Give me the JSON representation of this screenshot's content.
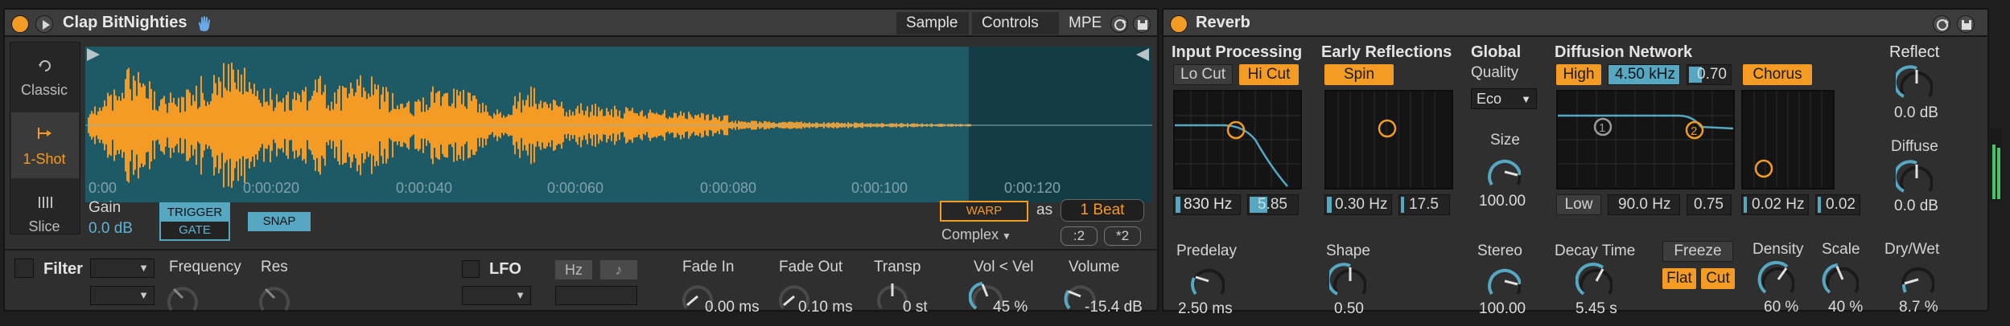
{
  "simpler": {
    "title": "Clap BitNighties",
    "tabs": [
      "Sample",
      "Controls",
      "MPE"
    ],
    "modes": {
      "classic": "Classic",
      "oneshot": "1-Shot",
      "slice": "Slice"
    },
    "timeline": [
      "0:00",
      "0:00:020",
      "0:00:040",
      "0:00:060",
      "0:00:080",
      "0:00:100",
      "0:00:120"
    ],
    "gain_label": "Gain",
    "gain_value": "0.0 dB",
    "trigger_label": "TRIGGER",
    "gate_label": "GATE",
    "snap_label": "SNAP",
    "warp_label": "WARP",
    "as_label": "as",
    "beat_value": "1 Beat",
    "warp_mode": "Complex",
    "half_label": ":2",
    "double_label": "*2",
    "filter_label": "Filter",
    "frequency_label": "Frequency",
    "res_label": "Res",
    "lfo_label": "LFO",
    "hz_label": "Hz",
    "note_glyph": "♪",
    "fade_in_label": "Fade In",
    "fade_in_value": "0.00 ms",
    "fade_out_label": "Fade Out",
    "fade_out_value": "0.10 ms",
    "transp_label": "Transp",
    "transp_value": "0 st",
    "volvel_label": "Vol < Vel",
    "volvel_value": "45 %",
    "volume_label": "Volume",
    "volume_value": "-15.4 dB"
  },
  "reverb": {
    "title": "Reverb",
    "input_processing": "Input Processing",
    "lo_cut": "Lo Cut",
    "hi_cut": "Hi Cut",
    "ip_freq": "830 Hz",
    "ip_q": "5.85",
    "early_reflections": "Early Reflections",
    "spin": "Spin",
    "er_amount": "0.30 Hz",
    "er_depth": "17.5",
    "global_label": "Global",
    "quality_label": "Quality",
    "quality_value": "Eco",
    "size_label": "Size",
    "size_value": "100.00",
    "diffusion_network": "Diffusion Network",
    "high_label": "High",
    "high_freq": "4.50 kHz",
    "high_q": "0.70",
    "chorus_label": "Chorus",
    "low_label": "Low",
    "low_freq": "90.0 Hz",
    "low_q": "0.75",
    "chorus_amount": "0.02 Hz",
    "chorus_depth": "0.02",
    "node1": "1",
    "node2": "2",
    "predelay_label": "Predelay",
    "predelay_value": "2.50 ms",
    "shape_label": "Shape",
    "shape_value": "0.50",
    "stereo_label": "Stereo",
    "stereo_value": "100.00",
    "decay_label": "Decay Time",
    "decay_value": "5.45 s",
    "freeze_label": "Freeze",
    "flat_label": "Flat",
    "cut_label": "Cut",
    "density_label": "Density",
    "density_value": "60 %",
    "scale_label": "Scale",
    "scale_value": "40 %",
    "reflect_label": "Reflect",
    "reflect_value": "0.0 dB",
    "diffuse_label": "Diffuse",
    "diffuse_value": "0.0 dB",
    "drywet_label": "Dry/Wet",
    "drywet_value": "8.7 %"
  },
  "colors": {
    "accent": "#f39b25",
    "blue": "#56a7c2",
    "wave_bg": "#1e5966",
    "panel": "#2f2f2f"
  }
}
